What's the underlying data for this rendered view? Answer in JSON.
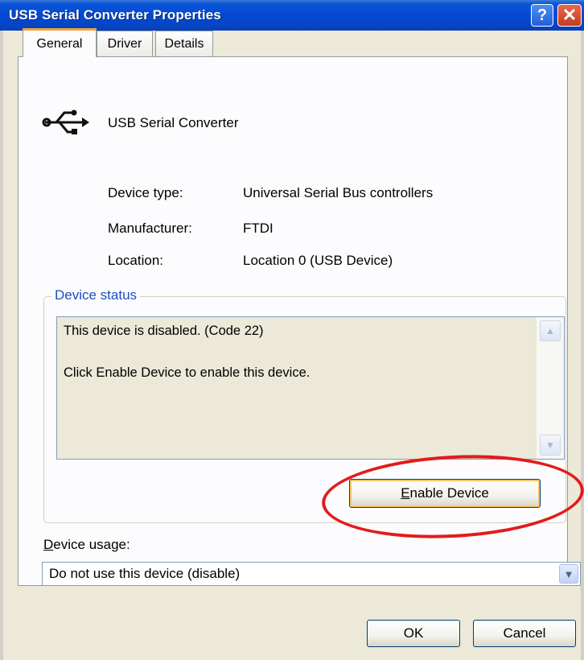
{
  "window": {
    "title": "USB Serial Converter Properties",
    "help_label": "?",
    "close_label": "✕"
  },
  "tabs": [
    {
      "label": "General",
      "active": true
    },
    {
      "label": "Driver",
      "active": false
    },
    {
      "label": "Details",
      "active": false
    }
  ],
  "device": {
    "icon": "usb-icon",
    "name": "USB Serial Converter",
    "properties": [
      {
        "label": "Device type:",
        "value": "Universal Serial Bus controllers"
      },
      {
        "label": "Manufacturer:",
        "value": "FTDI"
      },
      {
        "label": "Location:",
        "value": "Location 0 (USB Device)"
      }
    ]
  },
  "status": {
    "group_title": "Device status",
    "lines": [
      "This device is disabled. (Code 22)",
      "Click Enable Device to enable this device."
    ],
    "enable_button": {
      "mnemonic": "E",
      "rest": "nable Device"
    }
  },
  "usage": {
    "label_mnemonic": "D",
    "label_rest": "evice usage:",
    "selected": "Do not use this device (disable)"
  },
  "buttons": {
    "ok": "OK",
    "cancel": "Cancel"
  },
  "colors": {
    "titlebar": "#0549d1",
    "highlight": "#e31b1b",
    "group_title": "#1a4fbf"
  }
}
